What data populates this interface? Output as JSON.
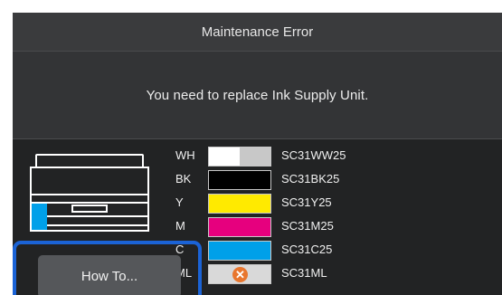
{
  "dialog": {
    "title": "Maintenance Error",
    "message": "You need to replace Ink Supply Unit."
  },
  "inks": [
    {
      "code": "WH",
      "part": "SC31WW25",
      "colors": [
        "#ffffff",
        "#c8c8c8"
      ],
      "status": "ok"
    },
    {
      "code": "BK",
      "part": "SC31BK25",
      "colors": [
        "#000000"
      ],
      "status": "ok"
    },
    {
      "code": "Y",
      "part": "SC31Y25",
      "colors": [
        "#ffea00"
      ],
      "status": "ok"
    },
    {
      "code": "M",
      "part": "SC31M25",
      "colors": [
        "#e6007e"
      ],
      "status": "ok"
    },
    {
      "code": "C",
      "part": "SC31C25",
      "colors": [
        "#00a0e9"
      ],
      "status": "ok"
    },
    {
      "code": "ML",
      "part": "SC31ML",
      "colors": [
        "#d9d9d9"
      ],
      "status": "error",
      "status_icon": "error-x-icon"
    }
  ],
  "printer_icon": "printer-icon",
  "buttons": {
    "how_to": "How To..."
  },
  "colors": {
    "highlight": "#1b63d6",
    "error_badge": "#e8762e",
    "cyan_ink_position": "#00a0e9"
  }
}
